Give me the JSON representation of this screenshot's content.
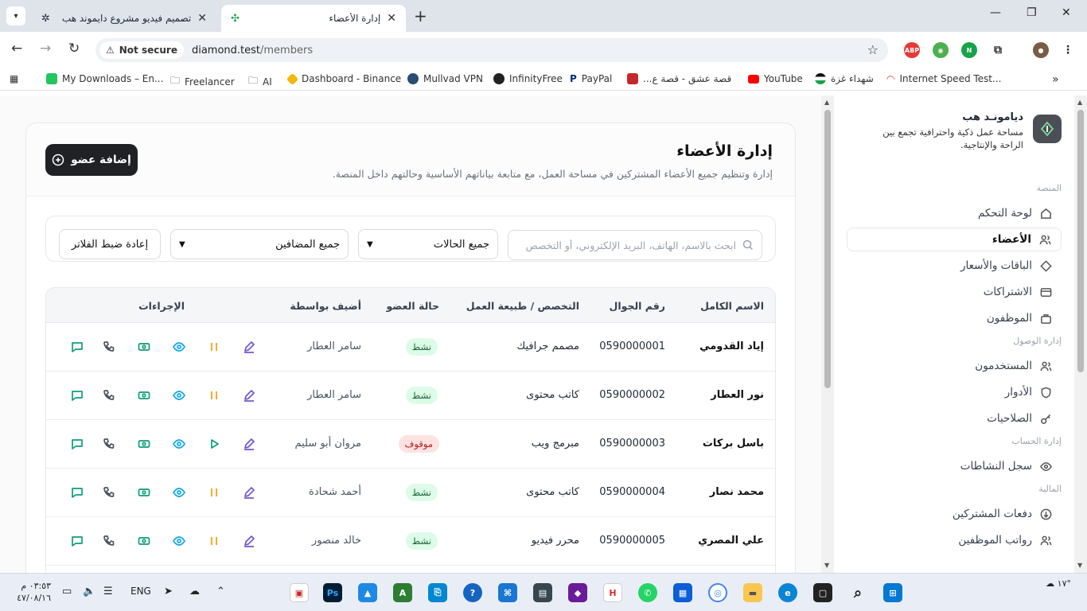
{
  "browser": {
    "tabs": [
      {
        "title": "تصميم فيديو مشروع دايموند هب",
        "active": false
      },
      {
        "title": "إدارة الأعضاء",
        "active": true
      }
    ],
    "security_label": "Not secure",
    "url_host": "diamond.test",
    "url_path": "/members",
    "bookmarks": [
      {
        "label": "My Downloads – En...",
        "color": "#22c55e"
      },
      {
        "label": "Freelancer",
        "color": "#6b7280"
      },
      {
        "label": "AI",
        "color": "#6b7280"
      },
      {
        "label": "Dashboard - Binance",
        "color": "#f0b90b"
      },
      {
        "label": "Mullvad VPN",
        "color": "#294d73"
      },
      {
        "label": "InfinityFree",
        "color": "#222222"
      },
      {
        "label": "PayPal",
        "color": "#003087"
      },
      {
        "label": "قصة عشق - قصة ع...",
        "color": "#c62828"
      },
      {
        "label": "YouTube",
        "color": "#ff0000"
      },
      {
        "label": "شهداء غزة",
        "color": "#111111"
      },
      {
        "label": "Internet Speed Test...",
        "color": "#e53935"
      }
    ]
  },
  "sidebar": {
    "brand_name": "ديامونـد هب",
    "brand_desc": "مساحة عمل ذكية واحترافية تجمع بين الراحة والإنتاجية.",
    "sections": [
      {
        "label": "المنصة",
        "items": [
          "لوحة التحكم",
          "الأعضاء",
          "الباقات والأسعار",
          "الاشتراكات",
          "الموظفون"
        ]
      },
      {
        "label": "إدارة الوصول",
        "items": [
          "المستخدمون",
          "الأدوار",
          "الصلاحيات"
        ]
      },
      {
        "label": "إدارة الحساب",
        "items": [
          "سجل النشاطات"
        ]
      },
      {
        "label": "المالية",
        "items": [
          "دفعات المشتركين",
          "رواتب الموظفين"
        ]
      }
    ],
    "active_item": "الأعضاء"
  },
  "header": {
    "title": "إدارة الأعضاء",
    "subtitle": "إدارة وتنظيم جميع الأعضاء المشتركين في مساحة العمل، مع متابعة بياناتهم الأساسية وحالتهم داخل المنصة.",
    "add_button": "إضافة عضو"
  },
  "filters": {
    "search_placeholder": "ابحث بالاسم، الهاتف، البريد الإلكتروني، أو التخصص",
    "status_value": "جميع الحالات",
    "added_by_value": "جميع المضافين",
    "reset_label": "إعادة ضبط الفلاتر"
  },
  "table": {
    "columns": [
      "الاسم الكامل",
      "رقم الجوال",
      "التخصص / طبيعة العمل",
      "حالة العضو",
      "أضيف بواسطة",
      "الإجراءات"
    ],
    "rows": [
      {
        "name": "إياد القدومي",
        "phone": "0590000001",
        "specialty": "مصمم جرافيك",
        "status": "نشط",
        "status_type": "active",
        "added_by": "سامر العطار"
      },
      {
        "name": "نور العطار",
        "phone": "0590000002",
        "specialty": "كاتب محتوى",
        "status": "نشط",
        "status_type": "active",
        "added_by": "سامر العطار"
      },
      {
        "name": "باسل بركات",
        "phone": "0590000003",
        "specialty": "مبرمج ويب",
        "status": "موقوف",
        "status_type": "stopped",
        "added_by": "مروان أبو سليم"
      },
      {
        "name": "محمد نصار",
        "phone": "0590000004",
        "specialty": "كاتب محتوى",
        "status": "نشط",
        "status_type": "active",
        "added_by": "أحمد شحادة"
      },
      {
        "name": "علي المصري",
        "phone": "0590000005",
        "specialty": "محرر فيديو",
        "status": "نشط",
        "status_type": "active",
        "added_by": "خالد منصور"
      }
    ]
  },
  "taskbar": {
    "time": "٠٣:٥٣ م",
    "date": "٤٧/٠٨/١٦",
    "language": "ENG",
    "temperature": "١٧°"
  },
  "colors": {
    "accent_dark": "#1f2125",
    "active_green": "#166534",
    "stopped_red": "#b91c1c",
    "edit_purple": "#6d5bd0",
    "pause_orange": "#f59e0b",
    "view_blue": "#0ea5e9",
    "teal": "#0f9d7a"
  }
}
